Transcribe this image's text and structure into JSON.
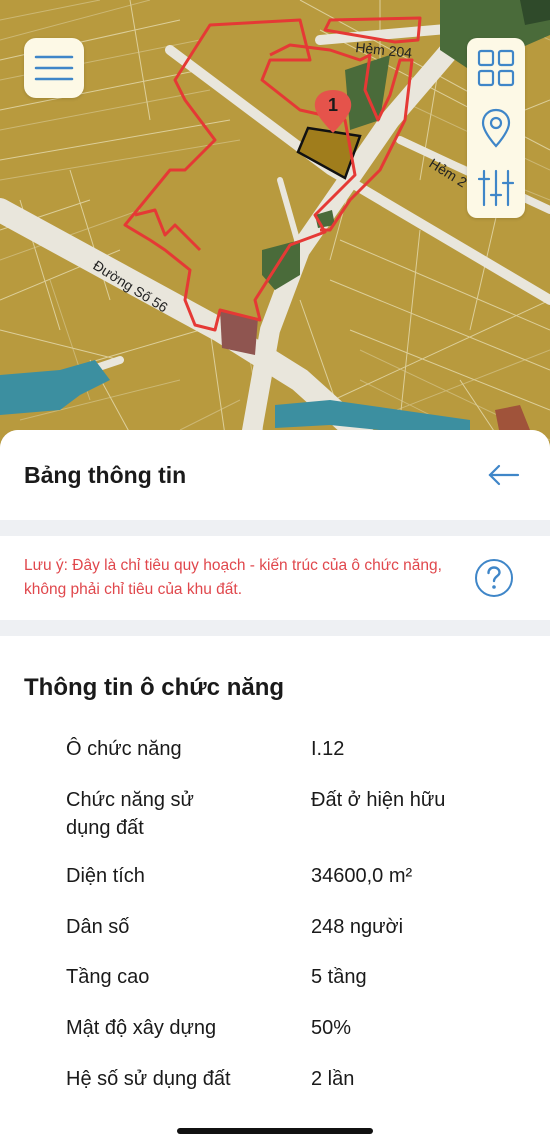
{
  "map": {
    "streets": [
      "Hẻm 204",
      "Đường Số 56",
      "Hẻm 2"
    ],
    "marker_label": "1",
    "colors": {
      "land": "#b89a3e",
      "road": "#e9e6dc",
      "highlight": "#e53935",
      "green": "#4a6b3a",
      "water": "#3c8fa0",
      "selected": "#a07d1c"
    }
  },
  "controls": {
    "menu_icon": "menu-icon",
    "layers_icon": "grid-icon",
    "location_icon": "location-pin-icon",
    "filter_icon": "sliders-icon"
  },
  "panel": {
    "title": "Bảng thông tin",
    "back_icon": "arrow-left-icon",
    "notice": "Lưu ý: Đây là chỉ tiêu quy hoạch - kiến trúc của ô chức năng, không phải chỉ tiêu của khu đất.",
    "help_icon": "question-icon",
    "section_title": "Thông tin ô chức năng",
    "rows": [
      {
        "label": "Ô chức năng",
        "value": "I.12"
      },
      {
        "label": "Chức năng sử dụng đất",
        "value": "Đất ở hiện hữu"
      },
      {
        "label": "Diện tích",
        "value": "34600,0 m²"
      },
      {
        "label": "Dân số",
        "value": "248 người"
      },
      {
        "label": "Tầng cao",
        "value": "5 tầng"
      },
      {
        "label": "Mật độ xây dựng",
        "value": "50%"
      },
      {
        "label": "Hệ số sử dụng đất",
        "value": "2 lần"
      }
    ]
  }
}
